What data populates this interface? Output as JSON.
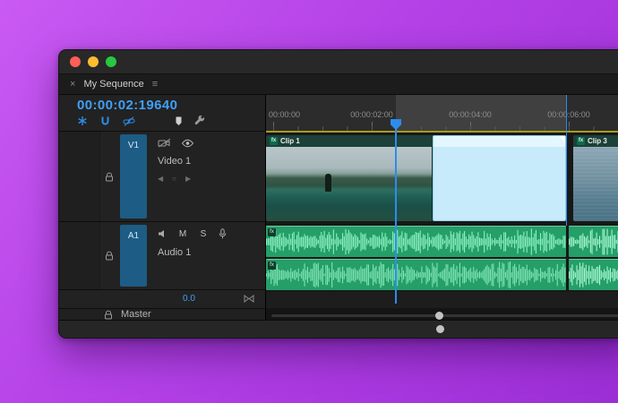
{
  "tab": {
    "close_label": "×",
    "title": "My Sequence",
    "menu_label": "≡"
  },
  "timecode": "00:00:02:19640",
  "toolbar": {
    "icons": [
      "nest",
      "snap-magnet",
      "linked-selection",
      "add-marker",
      "timeline-settings"
    ]
  },
  "ruler": {
    "labels": [
      "00:00:00",
      "00:00:02:00",
      "00:00:04:00",
      "00:00:06:00"
    ]
  },
  "tracks": {
    "v1": {
      "label": "V1",
      "name": "Video 1"
    },
    "a1": {
      "label": "A1",
      "name": "Audio 1",
      "mute": "M",
      "solo": "S"
    },
    "master": {
      "name": "Master"
    },
    "mixer": {
      "level": "0.0"
    }
  },
  "clips": {
    "clip1": {
      "badge": "fx",
      "name": "Clip 1"
    },
    "clip3": {
      "badge": "fx",
      "name": "Clip 3"
    },
    "audio": {
      "badge": "fx"
    }
  },
  "icons": {
    "prev_keyframe": "◀",
    "add_keyframe": "○",
    "next_keyframe": "▶"
  },
  "colors": {
    "accent_blue": "#2d8ceb",
    "timecode_blue": "#3fa0f7",
    "audio_green": "#259e68",
    "waveform_green": "#8bf0c0",
    "selection_blue": "#c7ebfa",
    "render_bar_yellow": "#a89b22",
    "background_purple": "#b341e6"
  }
}
